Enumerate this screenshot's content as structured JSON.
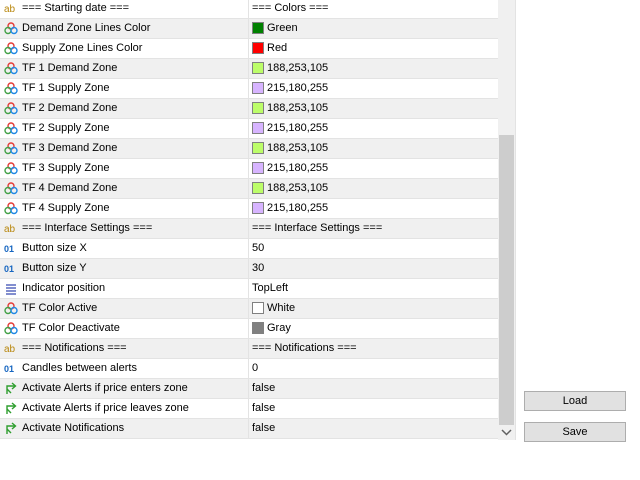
{
  "rows": [
    {
      "icon": "ab-icon",
      "name": "=== Starting date ===",
      "value": "=== Colors ==="
    },
    {
      "icon": "color-palette-icon",
      "name": "Demand Zone Lines Color",
      "value": "Green",
      "swatch": "#008000"
    },
    {
      "icon": "color-palette-icon",
      "name": "Supply Zone Lines Color",
      "value": "Red",
      "swatch": "#ff0000"
    },
    {
      "icon": "color-palette-icon",
      "name": "TF 1 Demand Zone",
      "value": "188,253,105",
      "swatch": "#bcfd69"
    },
    {
      "icon": "color-palette-icon",
      "name": "TF 1 Supply Zone",
      "value": "215,180,255",
      "swatch": "#d7b4ff"
    },
    {
      "icon": "color-palette-icon",
      "name": "TF 2 Demand Zone",
      "value": "188,253,105",
      "swatch": "#bcfd69"
    },
    {
      "icon": "color-palette-icon",
      "name": "TF 2 Supply Zone",
      "value": "215,180,255",
      "swatch": "#d7b4ff"
    },
    {
      "icon": "color-palette-icon",
      "name": "TF 3 Demand Zone",
      "value": "188,253,105",
      "swatch": "#bcfd69"
    },
    {
      "icon": "color-palette-icon",
      "name": "TF 3 Supply Zone",
      "value": "215,180,255",
      "swatch": "#d7b4ff"
    },
    {
      "icon": "color-palette-icon",
      "name": "TF 4 Demand Zone",
      "value": "188,253,105",
      "swatch": "#bcfd69"
    },
    {
      "icon": "color-palette-icon",
      "name": "TF 4 Supply Zone",
      "value": "215,180,255",
      "swatch": "#d7b4ff"
    },
    {
      "icon": "ab-icon",
      "name": "=== Interface Settings ===",
      "value": "=== Interface Settings ==="
    },
    {
      "icon": "integer-icon",
      "name": "Button size X",
      "value": "50"
    },
    {
      "icon": "integer-icon",
      "name": "Button size Y",
      "value": "30"
    },
    {
      "icon": "enum-list-icon",
      "name": "Indicator position",
      "value": "TopLeft"
    },
    {
      "icon": "color-palette-icon",
      "name": "TF Color Active",
      "value": "White",
      "swatch": "#ffffff"
    },
    {
      "icon": "color-palette-icon",
      "name": "TF Color Deactivate",
      "value": "Gray",
      "swatch": "#808080"
    },
    {
      "icon": "ab-icon",
      "name": "=== Notifications ===",
      "value": "=== Notifications ==="
    },
    {
      "icon": "integer-icon",
      "name": "Candles between alerts",
      "value": "0"
    },
    {
      "icon": "bool-arrow-icon",
      "name": "Activate Alerts if price enters zone",
      "value": "false"
    },
    {
      "icon": "bool-arrow-icon",
      "name": "Activate Alerts if price leaves zone",
      "value": "false"
    },
    {
      "icon": "bool-arrow-icon",
      "name": "Activate Notifications",
      "value": "false"
    }
  ],
  "buttons": {
    "load": "Load",
    "save": "Save"
  },
  "icon_colors": {
    "ab": "#b8860b",
    "palette": [
      "#e53935",
      "#43a047",
      "#1e88e5"
    ],
    "integer": "#1565c0",
    "enum": "#3f51b5",
    "bool": "#2e9e2e"
  }
}
